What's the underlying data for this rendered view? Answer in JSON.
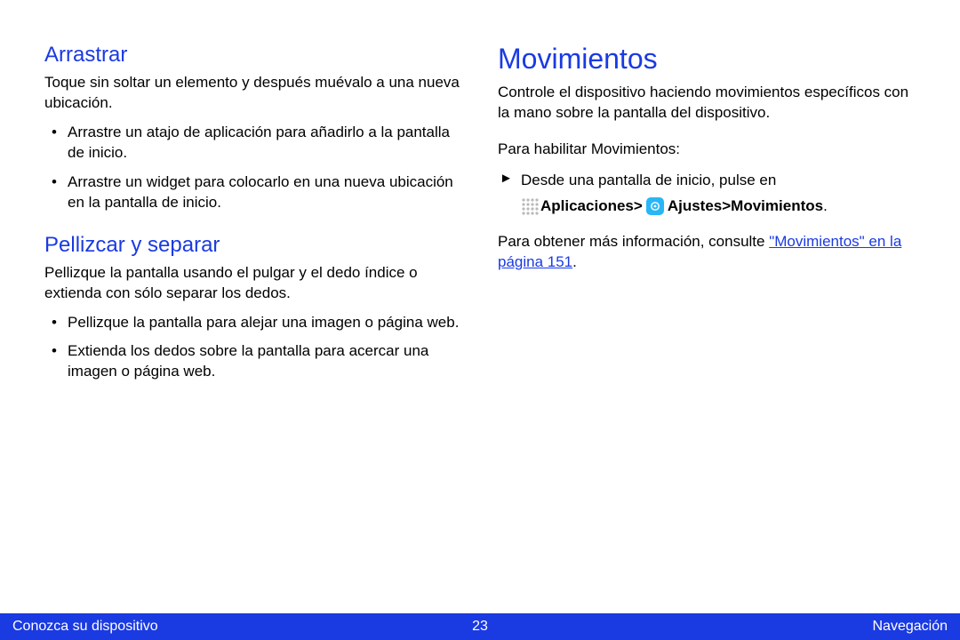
{
  "left": {
    "heading_drag": "Arrastrar",
    "drag_intro": "Toque sin soltar un elemento y después muévalo a una nueva ubicación.",
    "drag_items": [
      "Arrastre un atajo de aplicación para añadirlo a la pantalla de inicio.",
      "Arrastre un widget para colocarlo en una nueva ubicación en la pantalla de inicio."
    ],
    "heading_pinch": "Pellizcar y separar",
    "pinch_intro": "Pellizque la pantalla usando el pulgar y el dedo índice o extienda con sólo separar los dedos.",
    "pinch_items": [
      "Pellizque la pantalla para alejar una imagen o página web.",
      "Extienda los dedos sobre la pantalla para acercar una imagen o página web."
    ]
  },
  "right": {
    "heading": "Movimientos",
    "intro": "Controle el dispositivo haciendo movimientos específicos con la mano sobre la pantalla del dispositivo.",
    "enable_intro": "Para habilitar Movimientos:",
    "step_line": "Desde una pantalla de inicio, pulse en",
    "apps_label": "Aplicaciones",
    "sep1": " > ",
    "settings_label": "Ajustes",
    "sep2": " > ",
    "motions_label": "Movimientos",
    "period": ".",
    "more_info": "Para obtener más información, consulte ",
    "link_text": "\"Movimientos\" en la página 151"
  },
  "footer": {
    "left": "Conozca su dispositivo",
    "center": "23",
    "right": "Navegación"
  }
}
